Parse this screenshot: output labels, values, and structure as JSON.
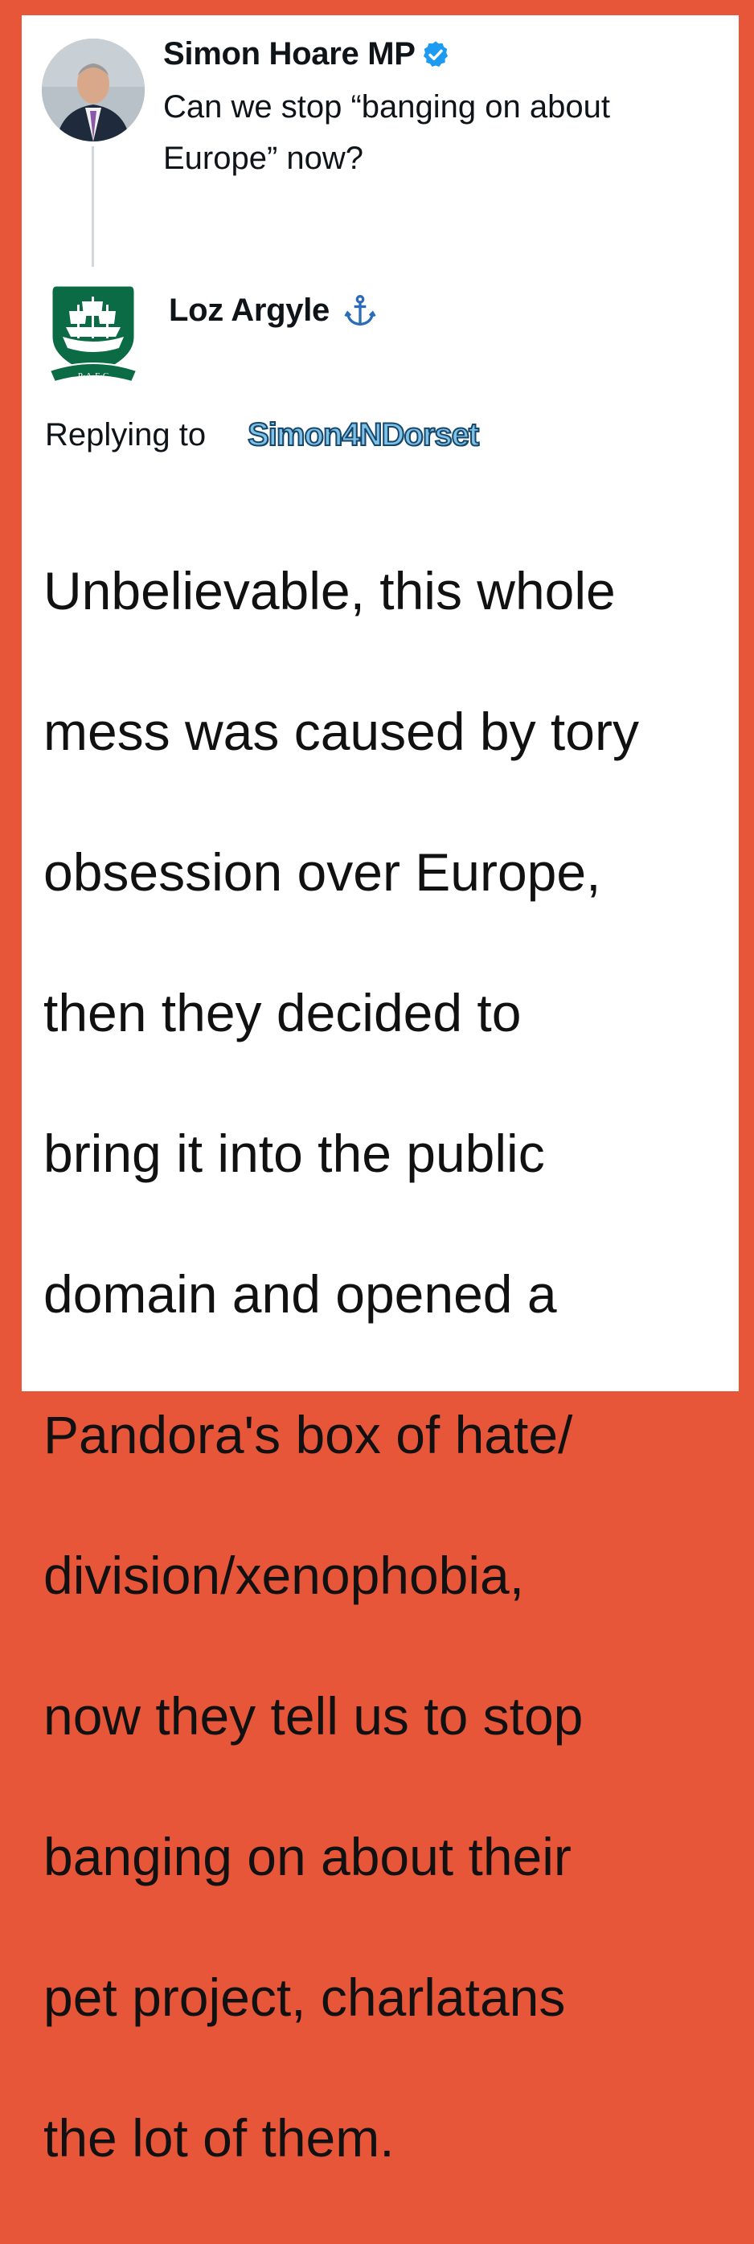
{
  "original_tweet": {
    "author_name": "Simon Hoare MP",
    "text": "Can we stop “banging on about Europe” now?",
    "verified_icon": "verified-badge-icon"
  },
  "reply": {
    "author_name": "Loz Argyle",
    "name_emoji": "anchor-icon",
    "replying_to_label": "Replying to",
    "replying_to_handle": "Simon4NDorset",
    "text": "Unbelievable, this whole mess was caused by tory obsession over Europe, then they decided to bring it into the public domain and opened a Pandora's box of hate/ division/xenophobia, now they tell us to stop banging on about their pet project, charlatans the lot of them.",
    "text_lines": [
      "Unbelievable, this whole",
      "mess was caused by tory",
      "obsession over Europe,",
      "then they decided to",
      "bring it into the public",
      "domain and opened a",
      "Pandora's box of hate/",
      "division/xenophobia,",
      "now they tell us to stop",
      "banging on about their",
      "pet project, charlatans",
      "the lot of them."
    ],
    "badge_text": "P·A·F·C"
  },
  "colors": {
    "border": "#E8563A",
    "verified": "#1D9BF0",
    "handle_fill": "#7fc2e8",
    "handle_outline": "#16466a",
    "anchor": "#2a6cb8",
    "club_green": "#0b6b45"
  }
}
